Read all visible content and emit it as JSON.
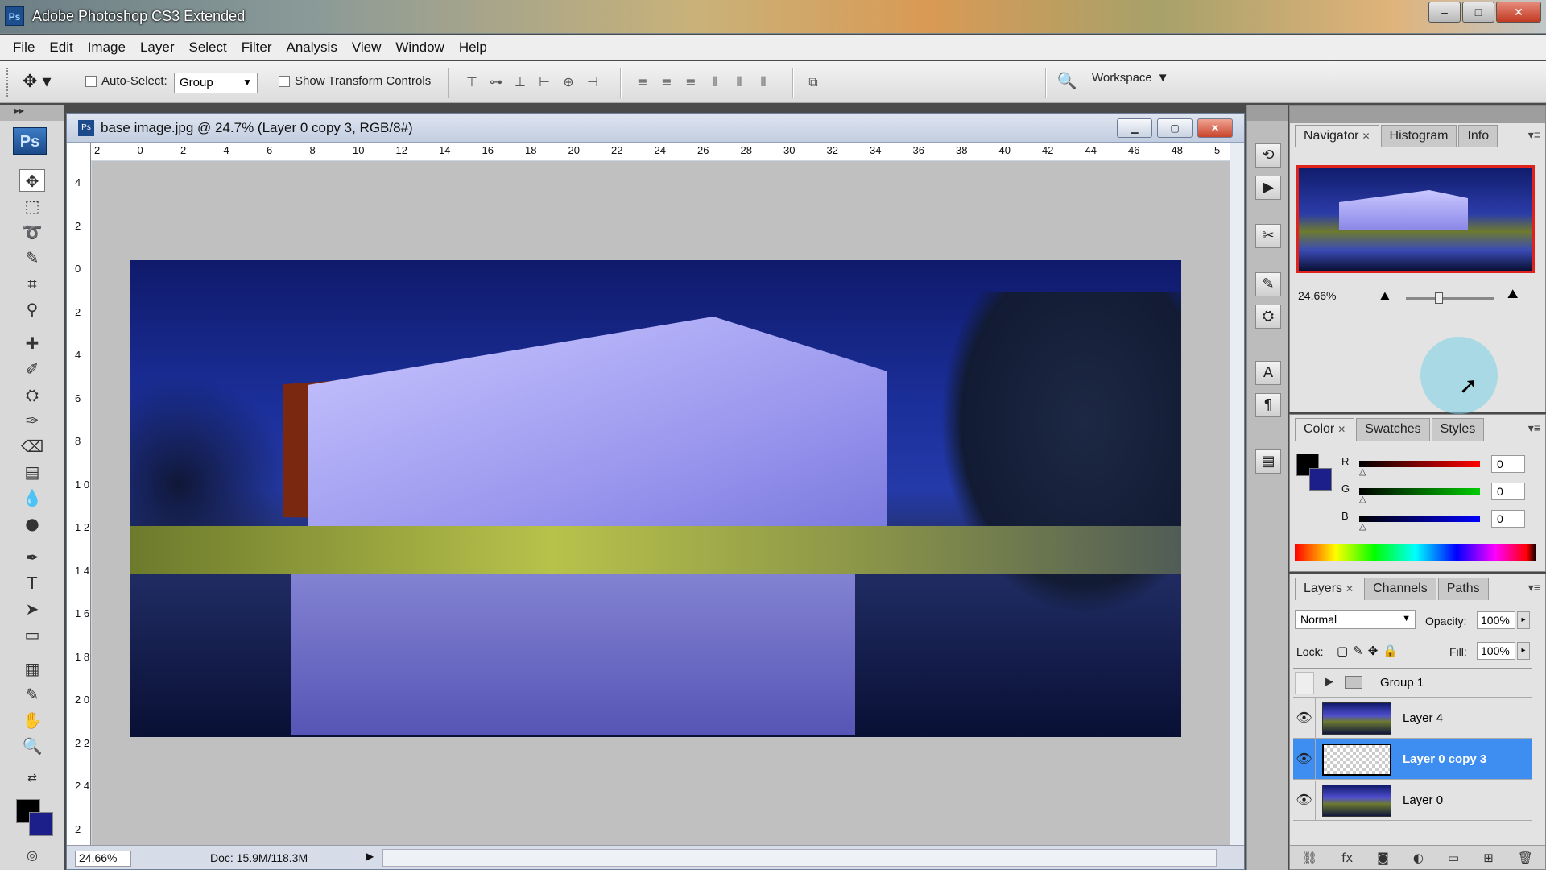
{
  "window": {
    "title": "Adobe Photoshop CS3 Extended",
    "app_icon": "Ps",
    "controls": {
      "minimize": "–",
      "maximize": "□",
      "close": "✕"
    }
  },
  "menu": [
    "File",
    "Edit",
    "Image",
    "Layer",
    "Select",
    "Filter",
    "Analysis",
    "View",
    "Window",
    "Help"
  ],
  "options_bar": {
    "auto_select_label": "Auto-Select:",
    "auto_select_checked": false,
    "auto_select_value": "Group",
    "show_transform_label": "Show Transform Controls",
    "show_transform_checked": false,
    "workspace_label": "Workspace"
  },
  "toolbox": {
    "logo": "Ps",
    "foreground_color": "#000000",
    "background_color": "#1c1f8a"
  },
  "document": {
    "title": "base image.jpg @ 24.7% (Layer 0 copy 3, RGB/8#)",
    "zoom": "24.66%",
    "doc_size": "Doc: 15.9M/118.3M",
    "ruler_top": [
      "2",
      "0",
      "2",
      "4",
      "6",
      "8",
      "10",
      "12",
      "14",
      "16",
      "18",
      "20",
      "22",
      "24",
      "26",
      "28",
      "30",
      "32",
      "34",
      "36",
      "38",
      "40",
      "42",
      "44",
      "46",
      "48",
      "5"
    ],
    "ruler_left": [
      "4",
      "2",
      "0",
      "2",
      "4",
      "6",
      "8",
      "1 0",
      "1 2",
      "1 4",
      "1 6",
      "1 8",
      "2 0",
      "2 2",
      "2 4",
      "2"
    ]
  },
  "navigator_panel": {
    "tabs": [
      "Navigator",
      "Histogram",
      "Info"
    ],
    "active_tab": "Navigator",
    "zoom": "24.66%"
  },
  "color_panel": {
    "tabs": [
      "Color",
      "Swatches",
      "Styles"
    ],
    "active_tab": "Color",
    "channels": [
      {
        "label": "R",
        "value": "0"
      },
      {
        "label": "G",
        "value": "0"
      },
      {
        "label": "B",
        "value": "0"
      }
    ]
  },
  "layers_panel": {
    "tabs": [
      "Layers",
      "Channels",
      "Paths"
    ],
    "active_tab": "Layers",
    "blend_mode": "Normal",
    "opacity_label": "Opacity:",
    "opacity": "100%",
    "lock_label": "Lock:",
    "fill_label": "Fill:",
    "fill": "100%",
    "group": {
      "name": "Group 1",
      "visible": false
    },
    "layers": [
      {
        "name": "Layer 4",
        "visible": true,
        "selected": false
      },
      {
        "name": "Layer 0 copy 3",
        "visible": true,
        "selected": true
      },
      {
        "name": "Layer 0",
        "visible": true,
        "selected": false
      }
    ]
  }
}
